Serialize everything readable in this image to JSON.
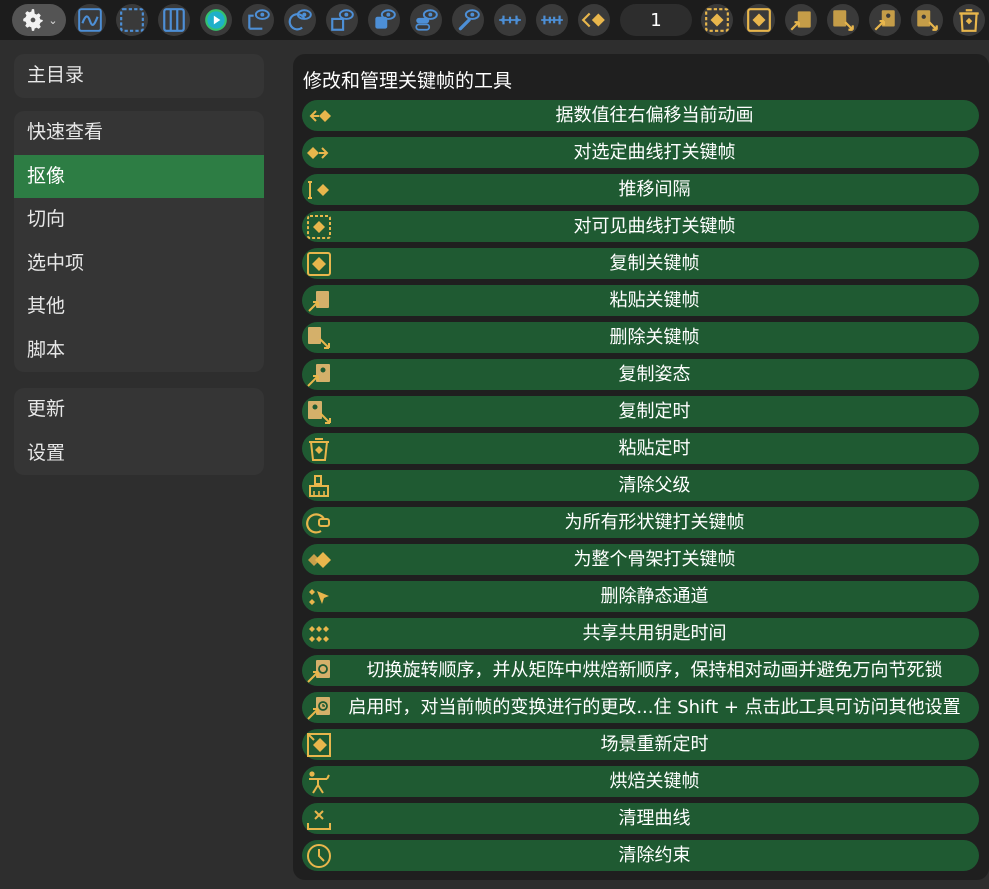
{
  "toolbar": {
    "gear": {
      "icon": "gear-icon"
    },
    "icons": [
      "graph-editor-icon",
      "select-visible-icon",
      "view-toggle-icon",
      "play-icon",
      "eye-axis-icon",
      "eye-rotate-icon",
      "eye-scale-icon",
      "eye-layers-icon",
      "eye-toggle-icon",
      "eye-link-icon",
      "timeline-spread-icon",
      "timeline-compress-icon",
      "key-left-icon",
      "key-right-icon"
    ],
    "frame_value": "1",
    "right_icons": [
      "key-visible-icon",
      "key-copy-icon",
      "key-paste-icon",
      "key-delete-icon",
      "pose-copy-icon",
      "timing-copy-icon",
      "timing-paste-icon"
    ]
  },
  "sidebar": {
    "groups": [
      {
        "items": [
          {
            "label": "主目录"
          }
        ]
      },
      {
        "items": [
          {
            "label": "快速查看"
          },
          {
            "label": "抠像",
            "active": true
          },
          {
            "label": "切向"
          },
          {
            "label": "选中项"
          },
          {
            "label": "其他"
          },
          {
            "label": "脚本"
          }
        ]
      },
      {
        "items": [
          {
            "label": "更新"
          },
          {
            "label": "设置"
          }
        ]
      }
    ]
  },
  "panel": {
    "title": "修改和管理关键帧的工具",
    "tools": [
      {
        "icon": "offset-key-left-icon",
        "label": "据数值往右偏移当前动画"
      },
      {
        "icon": "key-selected-curve-icon",
        "label": "对选定曲线打关键帧"
      },
      {
        "icon": "push-spacing-icon",
        "label": "推移间隔"
      },
      {
        "icon": "key-visible-curve-icon",
        "label": "对可见曲线打关键帧"
      },
      {
        "icon": "copy-key-icon",
        "label": "复制关键帧"
      },
      {
        "icon": "paste-key-icon",
        "label": "粘贴关键帧"
      },
      {
        "icon": "delete-key-icon",
        "label": "删除关键帧"
      },
      {
        "icon": "copy-pose-icon",
        "label": "复制姿态"
      },
      {
        "icon": "copy-timing-icon",
        "label": "复制定时"
      },
      {
        "icon": "paste-timing-icon",
        "label": "粘贴定时"
      },
      {
        "icon": "clear-parent-icon",
        "label": "清除父级"
      },
      {
        "icon": "shape-key-icon",
        "label": "为所有形状键打关键帧"
      },
      {
        "icon": "key-armature-icon",
        "label": "为整个骨架打关键帧"
      },
      {
        "icon": "delete-static-icon",
        "label": "删除静态通道"
      },
      {
        "icon": "share-keys-icon",
        "label": "共享共用钥匙时间"
      },
      {
        "icon": "rotation-order-icon",
        "label": "切换旋转顺序，并从矩阵中烘焙新顺序，保持相对动画并避免万向节死锁"
      },
      {
        "icon": "transform-change-icon",
        "label": "启用时，对当前帧的变换进行的更改...住 Shift + 点击此工具可访问其他设置"
      },
      {
        "icon": "retime-scene-icon",
        "label": "场景重新定时"
      },
      {
        "icon": "bake-keys-icon",
        "label": "烘焙关键帧"
      },
      {
        "icon": "clean-curve-icon",
        "label": "清理曲线"
      },
      {
        "icon": "clear-constraint-icon",
        "label": "清除约束"
      }
    ]
  },
  "colors": {
    "accent_active": "#2d7d44",
    "tool_row": "#1f5a32",
    "icon_gold": "#e8b64c",
    "icon_blue": "#4d8fd6"
  }
}
